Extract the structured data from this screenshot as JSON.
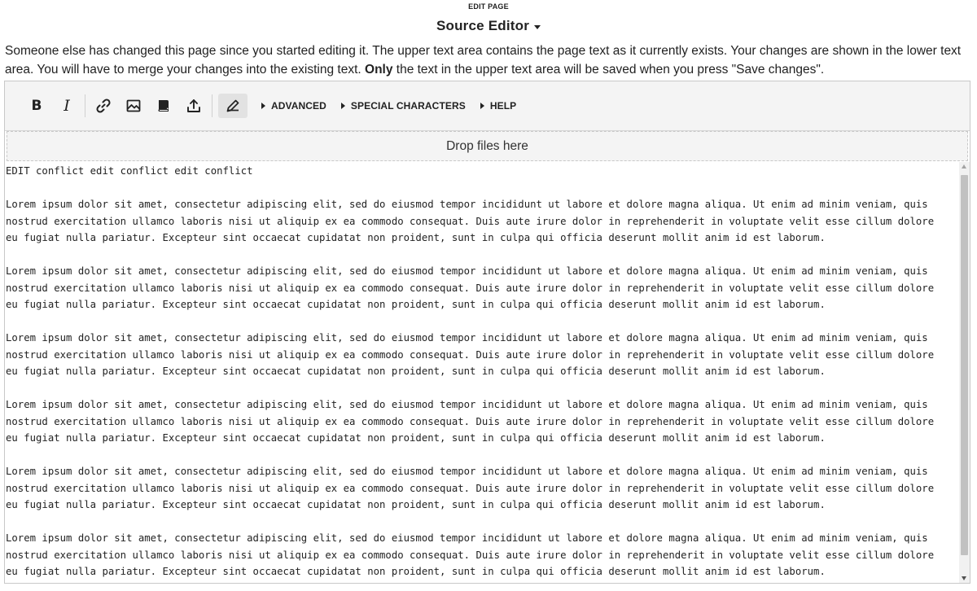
{
  "header": {
    "edit_label": "EDIT PAGE",
    "title": "Source Editor"
  },
  "notice": {
    "part1": "Someone else has changed this page since you started editing it. The upper text area contains the page text as it currently exists. Your changes are shown in the lower text area. You will have to merge your changes into the existing text. ",
    "bold": "Only",
    "part2": " the text in the upper text area will be saved when you press \"Save changes\"."
  },
  "toolbar": {
    "bold_label": "B",
    "italic_label": "I",
    "advanced_label": "ADVANCED",
    "special_label": "SPECIAL CHARACTERS",
    "help_label": "HELP",
    "icons": [
      "bold-icon",
      "italic-icon",
      "link-icon",
      "image-icon",
      "book-icon",
      "upload-icon",
      "pencil-icon"
    ]
  },
  "dropzone": {
    "label": "Drop files here"
  },
  "textarea": {
    "lines": [
      "EDIT conflict edit conflict edit conflict",
      "",
      "Lorem ipsum dolor sit amet, consectetur adipiscing elit, sed do eiusmod tempor incididunt ut labore et dolore magna aliqua. Ut enim ad minim veniam, quis",
      "nostrud exercitation ullamco laboris nisi ut aliquip ex ea commodo consequat. Duis aute irure dolor in reprehenderit in voluptate velit esse cillum dolore",
      "eu fugiat nulla pariatur. Excepteur sint occaecat cupidatat non proident, sunt in culpa qui officia deserunt mollit anim id est laborum.",
      "",
      "Lorem ipsum dolor sit amet, consectetur adipiscing elit, sed do eiusmod tempor incididunt ut labore et dolore magna aliqua. Ut enim ad minim veniam, quis",
      "nostrud exercitation ullamco laboris nisi ut aliquip ex ea commodo consequat. Duis aute irure dolor in reprehenderit in voluptate velit esse cillum dolore",
      "eu fugiat nulla pariatur. Excepteur sint occaecat cupidatat non proident, sunt in culpa qui officia deserunt mollit anim id est laborum.",
      "",
      "Lorem ipsum dolor sit amet, consectetur adipiscing elit, sed do eiusmod tempor incididunt ut labore et dolore magna aliqua. Ut enim ad minim veniam, quis",
      "nostrud exercitation ullamco laboris nisi ut aliquip ex ea commodo consequat. Duis aute irure dolor in reprehenderit in voluptate velit esse cillum dolore",
      "eu fugiat nulla pariatur. Excepteur sint occaecat cupidatat non proident, sunt in culpa qui officia deserunt mollit anim id est laborum.",
      "",
      "Lorem ipsum dolor sit amet, consectetur adipiscing elit, sed do eiusmod tempor incididunt ut labore et dolore magna aliqua. Ut enim ad minim veniam, quis",
      "nostrud exercitation ullamco laboris nisi ut aliquip ex ea commodo consequat. Duis aute irure dolor in reprehenderit in voluptate velit esse cillum dolore",
      "eu fugiat nulla pariatur. Excepteur sint occaecat cupidatat non proident, sunt in culpa qui officia deserunt mollit anim id est laborum.",
      "",
      "Lorem ipsum dolor sit amet, consectetur adipiscing elit, sed do eiusmod tempor incididunt ut labore et dolore magna aliqua. Ut enim ad minim veniam, quis",
      "nostrud exercitation ullamco laboris nisi ut aliquip ex ea commodo consequat. Duis aute irure dolor in reprehenderit in voluptate velit esse cillum dolore",
      "eu fugiat nulla pariatur. Excepteur sint occaecat cupidatat non proident, sunt in culpa qui officia deserunt mollit anim id est laborum.",
      "",
      "Lorem ipsum dolor sit amet, consectetur adipiscing elit, sed do eiusmod tempor incididunt ut labore et dolore magna aliqua. Ut enim ad minim veniam, quis",
      "nostrud exercitation ullamco laboris nisi ut aliquip ex ea commodo consequat. Duis aute irure dolor in reprehenderit in voluptate velit esse cillum dolore",
      "eu fugiat nulla pariatur. Excepteur sint occaecat cupidatat non proident, sunt in culpa qui officia deserunt mollit anim id est laborum."
    ]
  }
}
